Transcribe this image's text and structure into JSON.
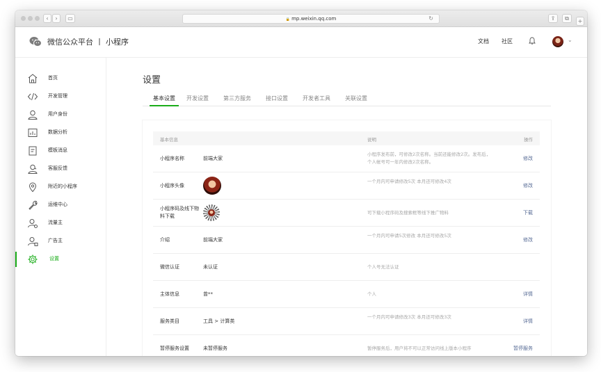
{
  "browser": {
    "url": "mp.weixin.qq.com",
    "lock": "🔒"
  },
  "header": {
    "brand": "微信公众平台 丨 小程序",
    "links": [
      "文档",
      "社区"
    ]
  },
  "sidebar": {
    "items": [
      {
        "label": "首页",
        "icon": "home-icon"
      },
      {
        "label": "开发管理",
        "icon": "code-icon"
      },
      {
        "label": "用户身份",
        "icon": "user-icon"
      },
      {
        "label": "数据分析",
        "icon": "chart-icon"
      },
      {
        "label": "模板消息",
        "icon": "document-icon"
      },
      {
        "label": "客服反馈",
        "icon": "support-icon"
      },
      {
        "label": "附近的小程序",
        "icon": "location-icon"
      },
      {
        "label": "运维中心",
        "icon": "wrench-icon"
      },
      {
        "label": "流量主",
        "icon": "user-money-icon"
      },
      {
        "label": "广告主",
        "icon": "user-ad-icon"
      },
      {
        "label": "设置",
        "icon": "gear-icon",
        "active": true
      }
    ]
  },
  "main": {
    "title": "设置",
    "tabs": [
      "基本设置",
      "开发设置",
      "第三方服务",
      "接口设置",
      "开发者工具",
      "关联设置"
    ],
    "active_tab": "基本设置",
    "table": {
      "headers": {
        "info": "基本信息",
        "desc": "说明",
        "op": "操作"
      },
      "rows": [
        {
          "name": "小程序名称",
          "value": "前端大家",
          "desc": "小程序发布前，可修改2次名称。当前还能修改2次。发布后，个人帐号可一年内修改2次名称。",
          "op": "修改"
        },
        {
          "name": "小程序头像",
          "value": "",
          "desc": "一个月内可申请修改5次 本月还可修改4次",
          "op": "修改"
        },
        {
          "name": "小程序码及线下物料下载",
          "value": "",
          "desc": "可下载小程序码及搜索框等线下推广物料",
          "op": "下载"
        },
        {
          "name": "介绍",
          "value": "前端大家",
          "desc": "一个月内可申请5次修改 本月还可修改5次",
          "op": "修改"
        },
        {
          "name": "微信认证",
          "value": "未认证",
          "desc": "个人号无法认证",
          "op": ""
        },
        {
          "name": "主体信息",
          "value": "曾**",
          "desc": "个人",
          "op": "详情"
        },
        {
          "name": "服务类目",
          "value": "工具 > 计算类",
          "desc": "一个月内可申请修改3次 本月还可修改3次",
          "op": "详情"
        },
        {
          "name": "暂停服务设置",
          "value": "未暂停服务",
          "desc": "暂停服务后，用户将不可以正常访问线上版本小程序",
          "op": "暂停服务"
        }
      ]
    }
  },
  "colors": {
    "accent": "#1aad19",
    "link": "#576b95"
  }
}
